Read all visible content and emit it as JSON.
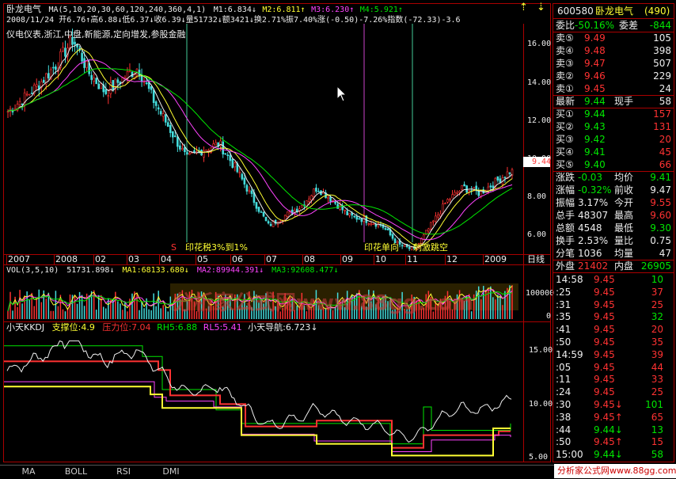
{
  "header": {
    "stock": "卧龙电气",
    "ma_params": "MA(5,10,20,30,60,120,240,360,4,1)",
    "m1": "M1:6.834↓",
    "m2": "M2:6.811↑",
    "m3": "M3:6.230↑",
    "m4": "M4:5.921↑",
    "line2": "2008/11/24 开6.76↑高6.88↓低6.37↓收6.39↓量51732↓额3421↓换2.71%振7.40%涨(-0.50)-7.26%指数(-72.33)-3.6",
    "tags": "仪电仪表,浙江,中盘,新能源,定向增发,参股金融",
    "up_arrow": "⇡",
    "down_arrow": "⇣"
  },
  "main_chart": {
    "y_ticks": [
      "16.00",
      "14.00",
      "12.00",
      "10.00",
      "8.00",
      "6.00"
    ],
    "current_price": "9.44",
    "annotations": [
      "印花税3%到1%",
      "印花单向",
      "刺激跳空"
    ],
    "s_marker": "S",
    "x_labels": [
      "2007",
      "2008",
      "02",
      "03",
      "04",
      "05",
      "06",
      "07",
      "08",
      "09",
      "10",
      "11",
      "12",
      "2009"
    ],
    "period": "日线"
  },
  "chart_data": [
    {
      "type": "line",
      "title": "",
      "series": [
        {
          "name": "价格",
          "values": [
            12.5,
            13.2,
            14.0,
            15.0,
            16.3,
            14.5,
            13.5,
            14.2,
            14.8,
            13.0,
            11.5,
            10.0,
            10.5,
            10.8,
            9.5,
            8.0,
            6.5,
            7.0,
            7.5,
            8.5,
            7.8,
            7.0,
            6.8,
            6.5,
            5.5,
            5.2,
            6.5,
            7.8,
            8.5,
            8.2,
            8.8,
            9.44
          ]
        }
      ],
      "ylim": [
        5,
        17
      ]
    },
    {
      "type": "bar",
      "title": "VOL(3,5,10)",
      "series": [
        {
          "name": "VOL",
          "values": [
            51731.898
          ]
        },
        {
          "name": "MA1",
          "values": [
            68133.68
          ]
        },
        {
          "name": "MA2",
          "values": [
            89944.391
          ]
        },
        {
          "name": "MA3",
          "values": [
            92608.477
          ]
        }
      ],
      "y_ticks": [
        "100000",
        "0"
      ]
    },
    {
      "type": "line",
      "title": "小天KKDJ",
      "series": [
        {
          "name": "支撑位",
          "values": [
            4.9
          ]
        },
        {
          "name": "压力位",
          "values": [
            7.04
          ]
        },
        {
          "name": "RH5",
          "values": [
            6.88
          ]
        },
        {
          "name": "RL5",
          "values": [
            5.41
          ]
        },
        {
          "name": "小天导航",
          "values": [
            6.723
          ]
        }
      ],
      "y_ticks": [
        "15.00",
        "10.00",
        "5.00"
      ]
    }
  ],
  "vol_panel": {
    "title": "VOL(3,5,10)",
    "vol": "51731.898↓",
    "ma1": "MA1:68133.680↓",
    "ma2": "MA2:89944.391↓",
    "ma3": "MA3:92608.477↓",
    "ticks": [
      "100000",
      "0"
    ]
  },
  "kdj_panel": {
    "title": "小天KKDJ",
    "support": "支撑位:4.9",
    "pressure": "压力位:7.04",
    "rh5": "RH5:6.88",
    "rl5": "RL5:5.41",
    "nav": "小天导航:6.723↓",
    "ticks": [
      "15.00",
      "10.00",
      "5.00"
    ]
  },
  "watermark": "分析家公式网www.88gg.com",
  "bottom_tabs": [
    "MA",
    "BOLL",
    "RSI",
    "DMI"
  ],
  "quote": {
    "code": "600580",
    "name": "卧龙电气",
    "number": "(490)",
    "weibi_label": "委比",
    "weibi": "-50.16%",
    "weicha_label": "委差",
    "weicha": "-844",
    "asks": [
      {
        "label": "卖⑤",
        "price": "9.49",
        "vol": "105"
      },
      {
        "label": "卖④",
        "price": "9.48",
        "vol": "398"
      },
      {
        "label": "卖③",
        "price": "9.47",
        "vol": "507"
      },
      {
        "label": "卖②",
        "price": "9.46",
        "vol": "229"
      },
      {
        "label": "卖①",
        "price": "9.45",
        "vol": "24"
      }
    ],
    "last_label": "最新",
    "last": "9.44",
    "hand_label": "现手",
    "hand": "58",
    "bids": [
      {
        "label": "买①",
        "price": "9.44",
        "vol": "157"
      },
      {
        "label": "买②",
        "price": "9.43",
        "vol": "131"
      },
      {
        "label": "买③",
        "price": "9.42",
        "vol": "20"
      },
      {
        "label": "买④",
        "price": "9.41",
        "vol": "45"
      },
      {
        "label": "买⑤",
        "price": "9.40",
        "vol": "66"
      }
    ],
    "stats": [
      {
        "l1": "涨跌",
        "v1": "-0.03",
        "l2": "均价",
        "v2": "9.41"
      },
      {
        "l1": "涨幅",
        "v1": "-0.32%",
        "l2": "前收",
        "v2": "9.47"
      },
      {
        "l1": "振幅",
        "v1": "3.17%",
        "l2": "今开",
        "v2": "9.55"
      },
      {
        "l1": "总手",
        "v1": "48307",
        "l2": "最高",
        "v2": "9.60"
      },
      {
        "l1": "总额",
        "v1": "4548",
        "l2": "最低",
        "v2": "9.30"
      },
      {
        "l1": "换手",
        "v1": "2.53%",
        "l2": "量比",
        "v2": "0.75"
      },
      {
        "l1": "分笔",
        "v1": "1036",
        "l2": "均量",
        "v2": "47"
      }
    ],
    "outer_label": "外盘",
    "outer": "21402",
    "inner_label": "内盘",
    "inner": "26905",
    "ticks": [
      {
        "time": "14:58",
        "price": "9.45",
        "vol": "10",
        "dir": ""
      },
      {
        "time": ":25",
        "price": "9.45",
        "vol": "37",
        "dir": "↑"
      },
      {
        "time": ":31",
        "price": "9.45",
        "vol": "25",
        "dir": ""
      },
      {
        "time": ":35",
        "price": "9.45",
        "vol": "32",
        "dir": ""
      },
      {
        "time": ":41",
        "price": "9.45",
        "vol": "20",
        "dir": ""
      },
      {
        "time": ":50",
        "price": "9.45",
        "vol": "35",
        "dir": ""
      },
      {
        "time": "14:59",
        "price": "9.45",
        "vol": "39",
        "dir": ""
      },
      {
        "time": ":05",
        "price": "9.45",
        "vol": "44",
        "dir": ""
      },
      {
        "time": ":11",
        "price": "9.45",
        "vol": "33",
        "dir": ""
      },
      {
        "time": ":24",
        "price": "9.45",
        "vol": "25",
        "dir": ""
      },
      {
        "time": ":30",
        "price": "9.45↓",
        "vol": "101",
        "dir": ""
      },
      {
        "time": ":38",
        "price": "9.45↑",
        "vol": "65",
        "dir": ""
      },
      {
        "time": ":44",
        "price": "9.44↓",
        "vol": "13",
        "dir": ""
      },
      {
        "time": ":50",
        "price": "9.45↑",
        "vol": "15",
        "dir": ""
      },
      {
        "time": "15:00",
        "price": "9.44↓",
        "vol": "58",
        "dir": ""
      }
    ]
  },
  "colors": {
    "up": "#ff3232",
    "down": "#00e600",
    "flat": "#eeeeee",
    "grid": "#aa0000",
    "accent": "#ffff33"
  }
}
